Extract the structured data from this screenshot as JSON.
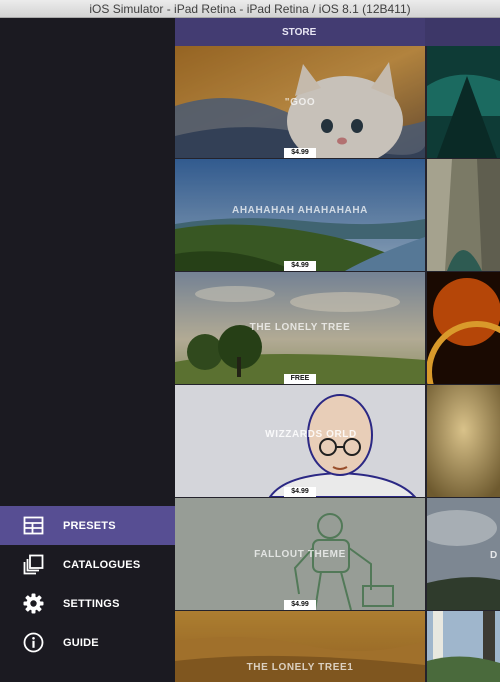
{
  "window": {
    "title": "iOS Simulator - iPad Retina - iPad Retina / iOS 8.1 (12B411)"
  },
  "menu": {
    "items": [
      {
        "label": "PRESETS",
        "icon": "presets-icon",
        "active": true
      },
      {
        "label": "CATALOGUES",
        "icon": "catalogues-icon",
        "active": false
      },
      {
        "label": "SETTINGS",
        "icon": "gear-icon",
        "active": false
      },
      {
        "label": "GUIDE",
        "icon": "info-icon",
        "active": false
      }
    ]
  },
  "store": {
    "title": "STORE",
    "presets": [
      {
        "title": "\"GOO",
        "price": "$4.99",
        "image": "kitten-photo"
      },
      {
        "title": "AHAHAHAH AHAHAHAHA",
        "price": "$4.99",
        "image": "river-valley-photo"
      },
      {
        "title": "THE LONELY TREE",
        "price": "FREE",
        "image": "misty-meadow-photo"
      },
      {
        "title": "WIZZARDS ORLD",
        "price": "$4.99",
        "image": "bald-man-illustration"
      },
      {
        "title": "FALLOUT THEME",
        "price": "$4.99",
        "image": "power-armor-sketch"
      },
      {
        "title": "THE LONELY TREE1",
        "price": "",
        "image": "desert-dunes-photo"
      }
    ],
    "side_column": [
      {
        "title": "",
        "image": "teal-shipwreck-photo"
      },
      {
        "title": "",
        "image": "canyon-cliffs-photo"
      },
      {
        "title": "",
        "image": "fiery-ring-photo"
      },
      {
        "title": "",
        "image": "golden-texture-photo"
      },
      {
        "title": "D",
        "image": "cloudy-sky-photo"
      },
      {
        "title": "",
        "image": "birch-trees-photo"
      }
    ]
  },
  "colors": {
    "sidebar": "#1b1a21",
    "accent": "#574e93",
    "header": "#433c72"
  }
}
